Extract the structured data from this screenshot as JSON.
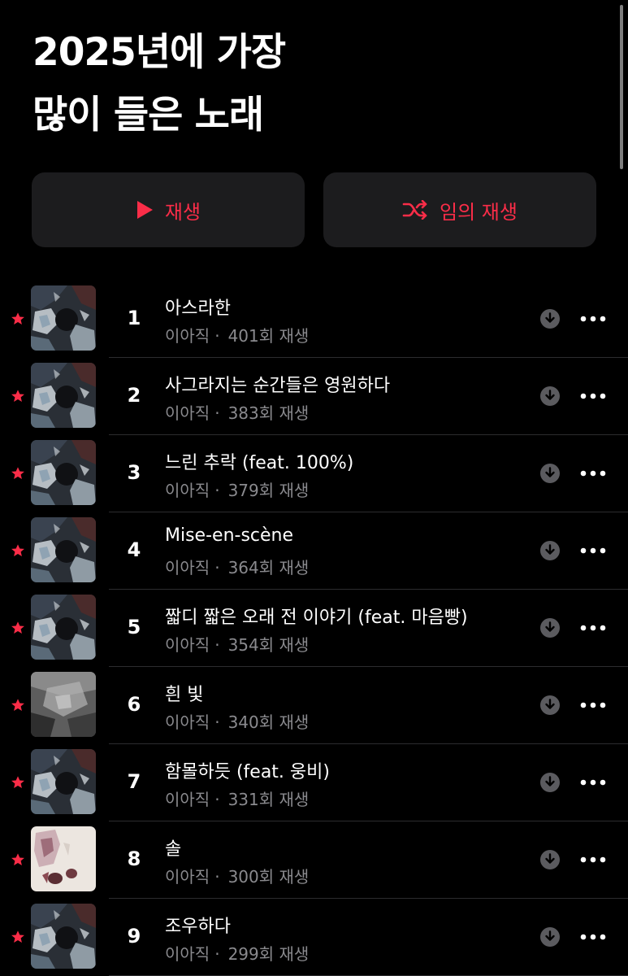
{
  "header": {
    "title_line1": "2025년에 가장",
    "title_line2": "많이 들은 노래"
  },
  "actions": {
    "play_label": "재생",
    "shuffle_label": "임의 재생"
  },
  "colors": {
    "accent": "#fa2d48",
    "background": "#000000",
    "button_bg": "#1c1c1e",
    "secondary_text": "#8a8a8e"
  },
  "tracks": [
    {
      "rank": "1",
      "title": "아스라한",
      "artist": "이아직",
      "plays": "401회 재생",
      "art": "dark"
    },
    {
      "rank": "2",
      "title": "사그라지는 순간들은 영원하다",
      "artist": "이아직",
      "plays": "383회 재생",
      "art": "dark"
    },
    {
      "rank": "3",
      "title": "느린 추락 (feat. 100%)",
      "artist": "이아직",
      "plays": "379회 재생",
      "art": "dark"
    },
    {
      "rank": "4",
      "title": "Mise-en-scène",
      "artist": "이아직",
      "plays": "364회 재생",
      "art": "dark"
    },
    {
      "rank": "5",
      "title": "짧디 짧은 오래 전 이야기 (feat. 마음빵)",
      "artist": "이아직",
      "plays": "354회 재생",
      "art": "dark"
    },
    {
      "rank": "6",
      "title": "흰 빛",
      "artist": "이아직",
      "plays": "340회 재생",
      "art": "grey"
    },
    {
      "rank": "7",
      "title": "함몰하듯 (feat. 웅비)",
      "artist": "이아직",
      "plays": "331회 재생",
      "art": "dark"
    },
    {
      "rank": "8",
      "title": "솔",
      "artist": "이아직",
      "plays": "300회 재생",
      "art": "light"
    },
    {
      "rank": "9",
      "title": "조우하다",
      "artist": "이아직",
      "plays": "299회 재생",
      "art": "dark"
    }
  ]
}
